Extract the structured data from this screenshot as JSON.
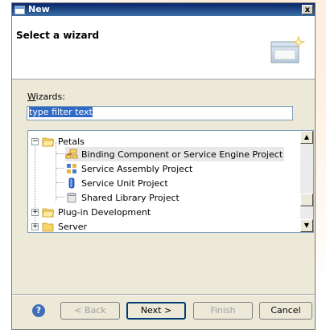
{
  "window": {
    "title": "New",
    "close_label": "x"
  },
  "header": {
    "title": "Select a wizard"
  },
  "wizards": {
    "label_accel": "W",
    "label_rest": "izards:",
    "filter_value": "type filter text"
  },
  "tree": {
    "items": [
      {
        "label": "Petals",
        "expander": "−",
        "icon": "folder-open-icon"
      },
      {
        "label": "Binding Component or Service Engine Project",
        "icon": "binding-component-icon"
      },
      {
        "label": "Service Assembly Project",
        "icon": "service-assembly-icon"
      },
      {
        "label": "Service Unit Project",
        "icon": "service-unit-icon"
      },
      {
        "label": "Shared Library Project",
        "icon": "shared-library-icon"
      },
      {
        "label": "Plug-in Development",
        "expander": "+",
        "icon": "folder-icon"
      },
      {
        "label": "Server",
        "expander": "+",
        "icon": "folder-icon"
      }
    ]
  },
  "buttons": {
    "help": "?",
    "back": "< Back",
    "next": "Next >",
    "finish": "Finish",
    "cancel": "Cancel"
  },
  "colors": {
    "titlebar": "#0a246a",
    "accent": "#316ac5",
    "folder": "#f4c54c"
  }
}
